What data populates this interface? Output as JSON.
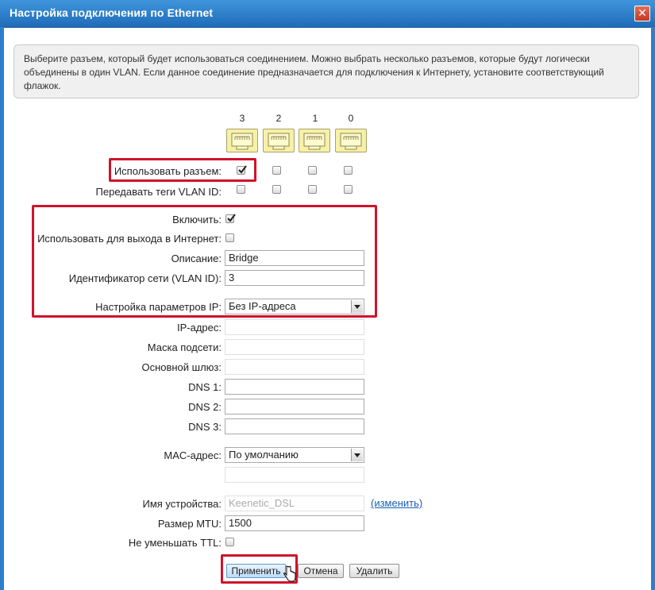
{
  "window": {
    "title": "Настройка подключения по Ethernet",
    "close_label": "✕"
  },
  "info": {
    "text": "Выберите разъем, который будет использоваться соединением. Можно выбрать несколько разъемов, которые будут логически объединены в один VLAN. Если данное соединение предназначается для подключения к Интернету, установите соответствующий флажок."
  },
  "ports": {
    "numbers": [
      "3",
      "2",
      "1",
      "0"
    ],
    "use_port_label": "Использовать разъем:",
    "use_port_checked": [
      true,
      false,
      false,
      false
    ],
    "vlan_tags_label": "Передавать теги VLAN ID:",
    "vlan_tags_checked": [
      false,
      false,
      false,
      false
    ]
  },
  "form": {
    "enable_label": "Включить:",
    "enable_checked": true,
    "internet_label": "Использовать для выхода в Интернет:",
    "internet_checked": false,
    "description_label": "Описание:",
    "description_value": "Bridge",
    "vlan_id_label": "Идентификатор сети (VLAN ID):",
    "vlan_id_value": "3",
    "ip_settings_label": "Настройка параметров IP:",
    "ip_settings_value": "Без IP-адреса",
    "ip_label": "IP-адрес:",
    "mask_label": "Маска подсети:",
    "gateway_label": "Основной шлюз:",
    "dns1_label": "DNS 1:",
    "dns2_label": "DNS 2:",
    "dns3_label": "DNS 3:",
    "mac_label": "MAC-адрес:",
    "mac_value": "По умолчанию",
    "device_name_label": "Имя устройства:",
    "device_name_value": "Keenetic_DSL",
    "change_link": "(изменить)",
    "mtu_label": "Размер MTU:",
    "mtu_value": "1500",
    "ttl_label": "Не уменьшать TTL:",
    "ttl_checked": false
  },
  "buttons": {
    "apply": "Применить",
    "cancel": "Отмена",
    "delete": "Удалить"
  },
  "colors": {
    "title_bar": "#2e7fcb",
    "highlight": "#d0132a",
    "port": "#f7f0a7"
  }
}
